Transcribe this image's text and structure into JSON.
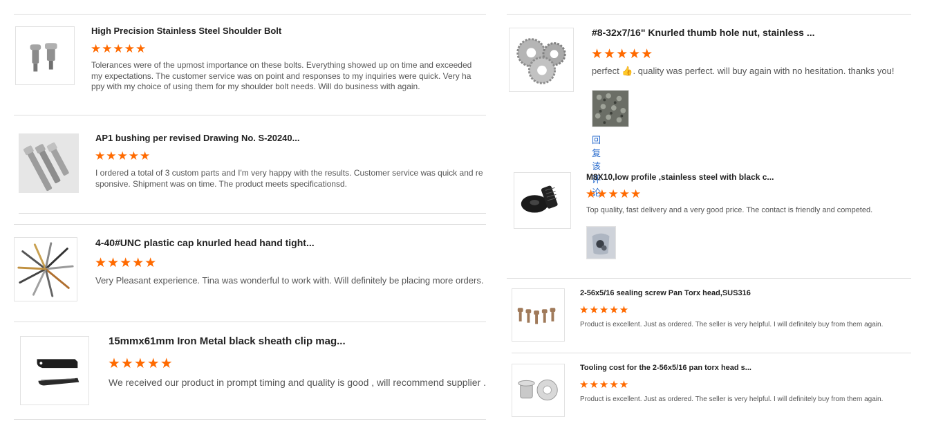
{
  "left": [
    {
      "title": "High Precision Stainless Steel Shoulder Bolt",
      "stars": "★★★★★",
      "text": "Tolerances were of the upmost importance on these bolts.  Everything showed up on time and exceeded my expectations.  The customer service was on point and responses to my inquiries were quick.  Very happy with my choice of using them for my shoulder bolt needs.  Will do business with again.",
      "icon": "shoulder-bolt-icon"
    },
    {
      "title": "AP1 bushing per revised Drawing No. S-20240...",
      "stars": "★★★★★",
      "text": "I ordered a total of 3 custom parts and I'm very happy with the results. Customer service was quick and responsive. Shipment was on time. The product meets specificationsd.",
      "icon": "socket-bolts-icon"
    },
    {
      "title": "4-40#UNC plastic cap knurled head hand tight...",
      "stars": "★★★★★",
      "text": "Very Pleasant experience.  Tina was wonderful to work with.  Will definitely be placing more orders.",
      "icon": "assorted-screws-icon"
    },
    {
      "title": "15mmx61mm Iron Metal black sheath clip mag...",
      "stars": "★★★★★",
      "text": "We received our product in prompt timing and quality is good , will recommend supplier .",
      "icon": "sheath-clip-icon"
    }
  ],
  "right": [
    {
      "title": "#8-32x7/16\" Knurled thumb hole nut, stainless ...",
      "stars": "★★★★★",
      "text_before": "perfect ",
      "emoji": "👍",
      "text_after": ". quality was perfect. will buy again with no hesitation. thanks you!",
      "reply": "回复该评论",
      "icon": "knurled-nut-icon",
      "photo": "nuts-pile-photo"
    },
    {
      "title": "M8X10,low profile ,stainless steel with black c...",
      "stars": "★★★★★",
      "text": "Top quality, fast delivery and a very good price. The contact is friendly and competed.",
      "icon": "black-screw-icon",
      "photo": "screw-bag-photo"
    },
    {
      "title": "2-56x5/16 sealing screw Pan Torx head,SUS316",
      "stars": "★★★★★",
      "text": "Product is excellent.  Just as ordered.  The seller is very helpful.  I will definitely buy from them again.",
      "icon": "torx-screws-icon"
    },
    {
      "title": "Tooling cost for the 2-56x5/16 pan torx head s...",
      "stars": "★★★★★",
      "text": "Product is excellent.  Just as ordered.  The seller is very helpful.  I will definitely buy from them again.",
      "icon": "tooling-parts-icon"
    }
  ]
}
